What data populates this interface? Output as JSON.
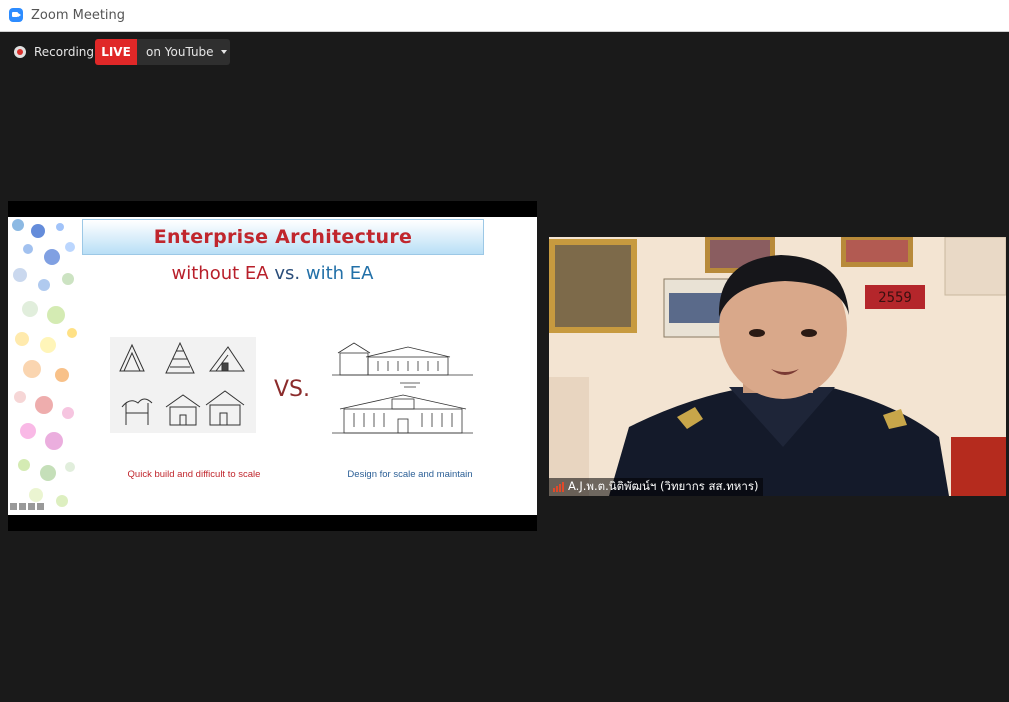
{
  "window": {
    "title": "Zoom Meeting",
    "accent": "#2D8CFF"
  },
  "toolbar": {
    "recording_label": "Recording",
    "live_badge": "LIVE",
    "live_destination": "on YouTube",
    "live_color": "#E02828"
  },
  "shared_screen": {
    "slide_title": "Enterprise  Architecture",
    "subtitle_left": "without EA",
    "subtitle_vs": "vs.",
    "subtitle_right": "with EA",
    "center_vs": "VS.",
    "caption_left": "Quick build and difficult to scale",
    "caption_right": "Design for scale and maintain"
  },
  "participant": {
    "name": "A.J.พ.ต.นิติพัฒน์ฯ (วิทยากร สส.ทหาร)",
    "frame_number": "2559"
  }
}
